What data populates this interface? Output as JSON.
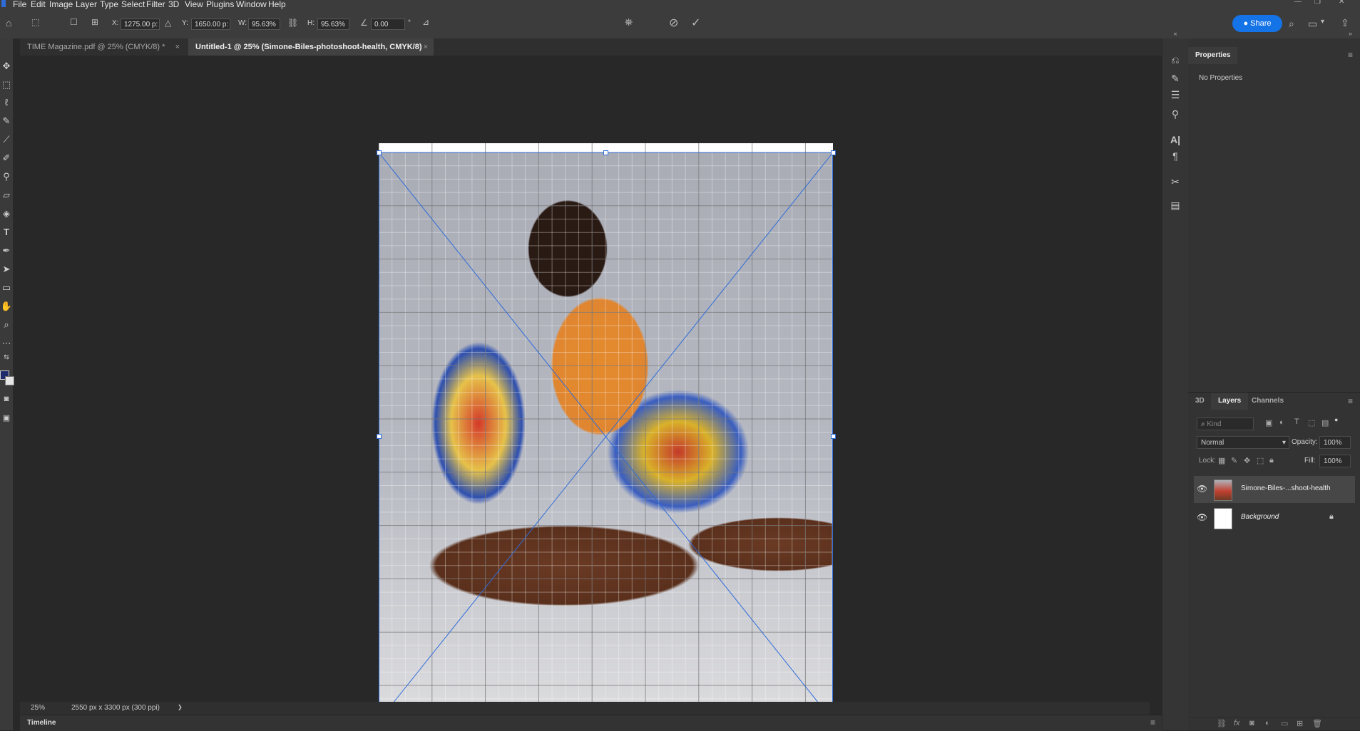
{
  "menubar": {
    "items": [
      "File",
      "Edit",
      "Image",
      "Layer",
      "Type",
      "Select",
      "Filter",
      "3D",
      "View",
      "Plugins",
      "Window",
      "Help"
    ]
  },
  "options": {
    "x_label": "X:",
    "x_value": "1275.00 p:",
    "y_label": "Y:",
    "y_value": "1650.00 p:",
    "w_label": "W:",
    "w_value": "95.63%",
    "h_label": "H:",
    "h_value": "95.63%",
    "angle_value": "0.00",
    "degree": "°",
    "share_label": "Share"
  },
  "tabs": [
    {
      "label": "TIME Magazine.pdf @ 25% (CMYK/8) *",
      "close": "×"
    },
    {
      "label": "Untitled-1 @ 25% (Simone-Biles-photoshoot-health, CMYK/8)",
      "close": "×"
    }
  ],
  "status": {
    "zoom": "25%",
    "doc_info": "2550 px x 3300 px (300 ppi)",
    "arrow": "❯"
  },
  "timeline": {
    "label": "Timeline"
  },
  "properties": {
    "tab_label": "Properties",
    "empty_text": "No Properties"
  },
  "layers_panel": {
    "tabs": [
      "3D",
      "Layers",
      "Channels"
    ],
    "kind_placeholder": "Kind",
    "blend_mode": "Normal",
    "opacity_label": "Opacity:",
    "opacity_value": "100%",
    "lock_label": "Lock:",
    "fill_label": "Fill:",
    "fill_value": "100%",
    "layers": [
      {
        "name": "Simone-Biles-...shoot-health",
        "selected": true
      },
      {
        "name": "Background",
        "selected": false
      }
    ]
  },
  "colors": {
    "accent": "#1473e6",
    "transform_lines": "#2f6cd8",
    "foreground_swatch": "#1d2a6b",
    "background_swatch": "#e6e6e6"
  }
}
